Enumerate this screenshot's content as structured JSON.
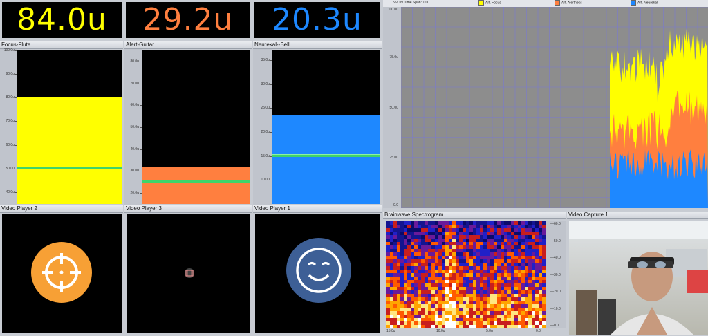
{
  "readouts": [
    {
      "value": "84.0u",
      "color": "#ffff00"
    },
    {
      "value": "29.2u",
      "color": "#ff7f3f"
    },
    {
      "value": "20.3u",
      "color": "#1e88ff"
    }
  ],
  "meters": [
    {
      "title": "Focus-Flute",
      "ticks": [
        "100.0u",
        "90.0u",
        "80.0u",
        "70.0u",
        "60.0u",
        "50.0u",
        "40.0u"
      ],
      "min": 35,
      "max": 100,
      "level": 80,
      "threshold": 50,
      "color": "#ffff00"
    },
    {
      "title": "Alert-Guitar",
      "ticks": [
        "80.0u",
        "70.0u",
        "60.0u",
        "50.0u",
        "40.0u",
        "30.0u",
        "20.0u"
      ],
      "min": 15,
      "max": 85,
      "level": 32,
      "threshold": 25,
      "color": "#ff7f3f"
    },
    {
      "title": "Neurekal--Bell",
      "ticks": [
        "35.0u",
        "30.0u",
        "25.0u",
        "20.0u",
        "15.0u",
        "10.0u"
      ],
      "min": 5,
      "max": 37,
      "level": 23.5,
      "threshold": 15,
      "color": "#1e88ff"
    }
  ],
  "video_players": [
    {
      "title": "Video Player 2",
      "icon": "crosshair-icon",
      "circle_color": "#f7a035"
    },
    {
      "title": "Video Player 3",
      "icon": "film-icon",
      "circle_color": "#444444"
    },
    {
      "title": "Video Player 1",
      "icon": "smiley-icon",
      "circle_color": "#3d5f96"
    }
  ],
  "graph": {
    "header": "55/DIV   Time Span: 1:00",
    "legend": [
      {
        "label": "Art. Focus",
        "color": "#ffff00"
      },
      {
        "label": "Art. Alertness",
        "color": "#ff7f3f"
      },
      {
        "label": "Art. Neurekal",
        "color": "#1e88ff"
      }
    ],
    "ticks": [
      "100.0u",
      "75.0u",
      "50.0u",
      "25.0u",
      "0.0"
    ]
  },
  "spectrogram": {
    "title": "Brainwave Spectrogram",
    "right_ticks": [
      "60.0",
      "50.0",
      "40.0",
      "30.0",
      "20.0",
      "10.0",
      "0.0"
    ],
    "bottom_ticks": [
      "15.0u",
      "10.0u",
      "5.0u",
      "0.0"
    ]
  },
  "capture": {
    "title": "Video Capture 1"
  }
}
